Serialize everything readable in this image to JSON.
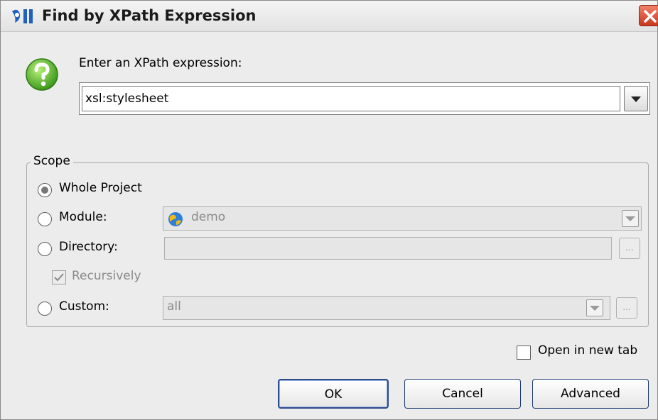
{
  "window": {
    "title": "Find by XPath Expression",
    "icons": {
      "app": "intellij-icon",
      "close": "close-icon"
    },
    "colors": {
      "close_button": "#d04a30"
    }
  },
  "expression": {
    "label": "Enter an XPath expression:",
    "value": "xsl:stylesheet",
    "help_icon": "question-icon"
  },
  "scope": {
    "legend": "Scope",
    "options": {
      "whole_project": {
        "label": "Whole Project",
        "selected": true
      },
      "module": {
        "label": "Module:",
        "selected": false,
        "value": "demo",
        "icon": "module-globe-icon"
      },
      "directory": {
        "label": "Directory:",
        "selected": false,
        "value": "",
        "browse_label": "..."
      },
      "recursively": {
        "label": "Recursively",
        "checked": true
      },
      "custom": {
        "label": "Custom:",
        "selected": false,
        "value": "all",
        "browse_label": "..."
      }
    }
  },
  "open_in_new_tab": {
    "label": "Open in new tab",
    "checked": false
  },
  "buttons": {
    "ok": "OK",
    "cancel": "Cancel",
    "advanced": "Advanced"
  }
}
